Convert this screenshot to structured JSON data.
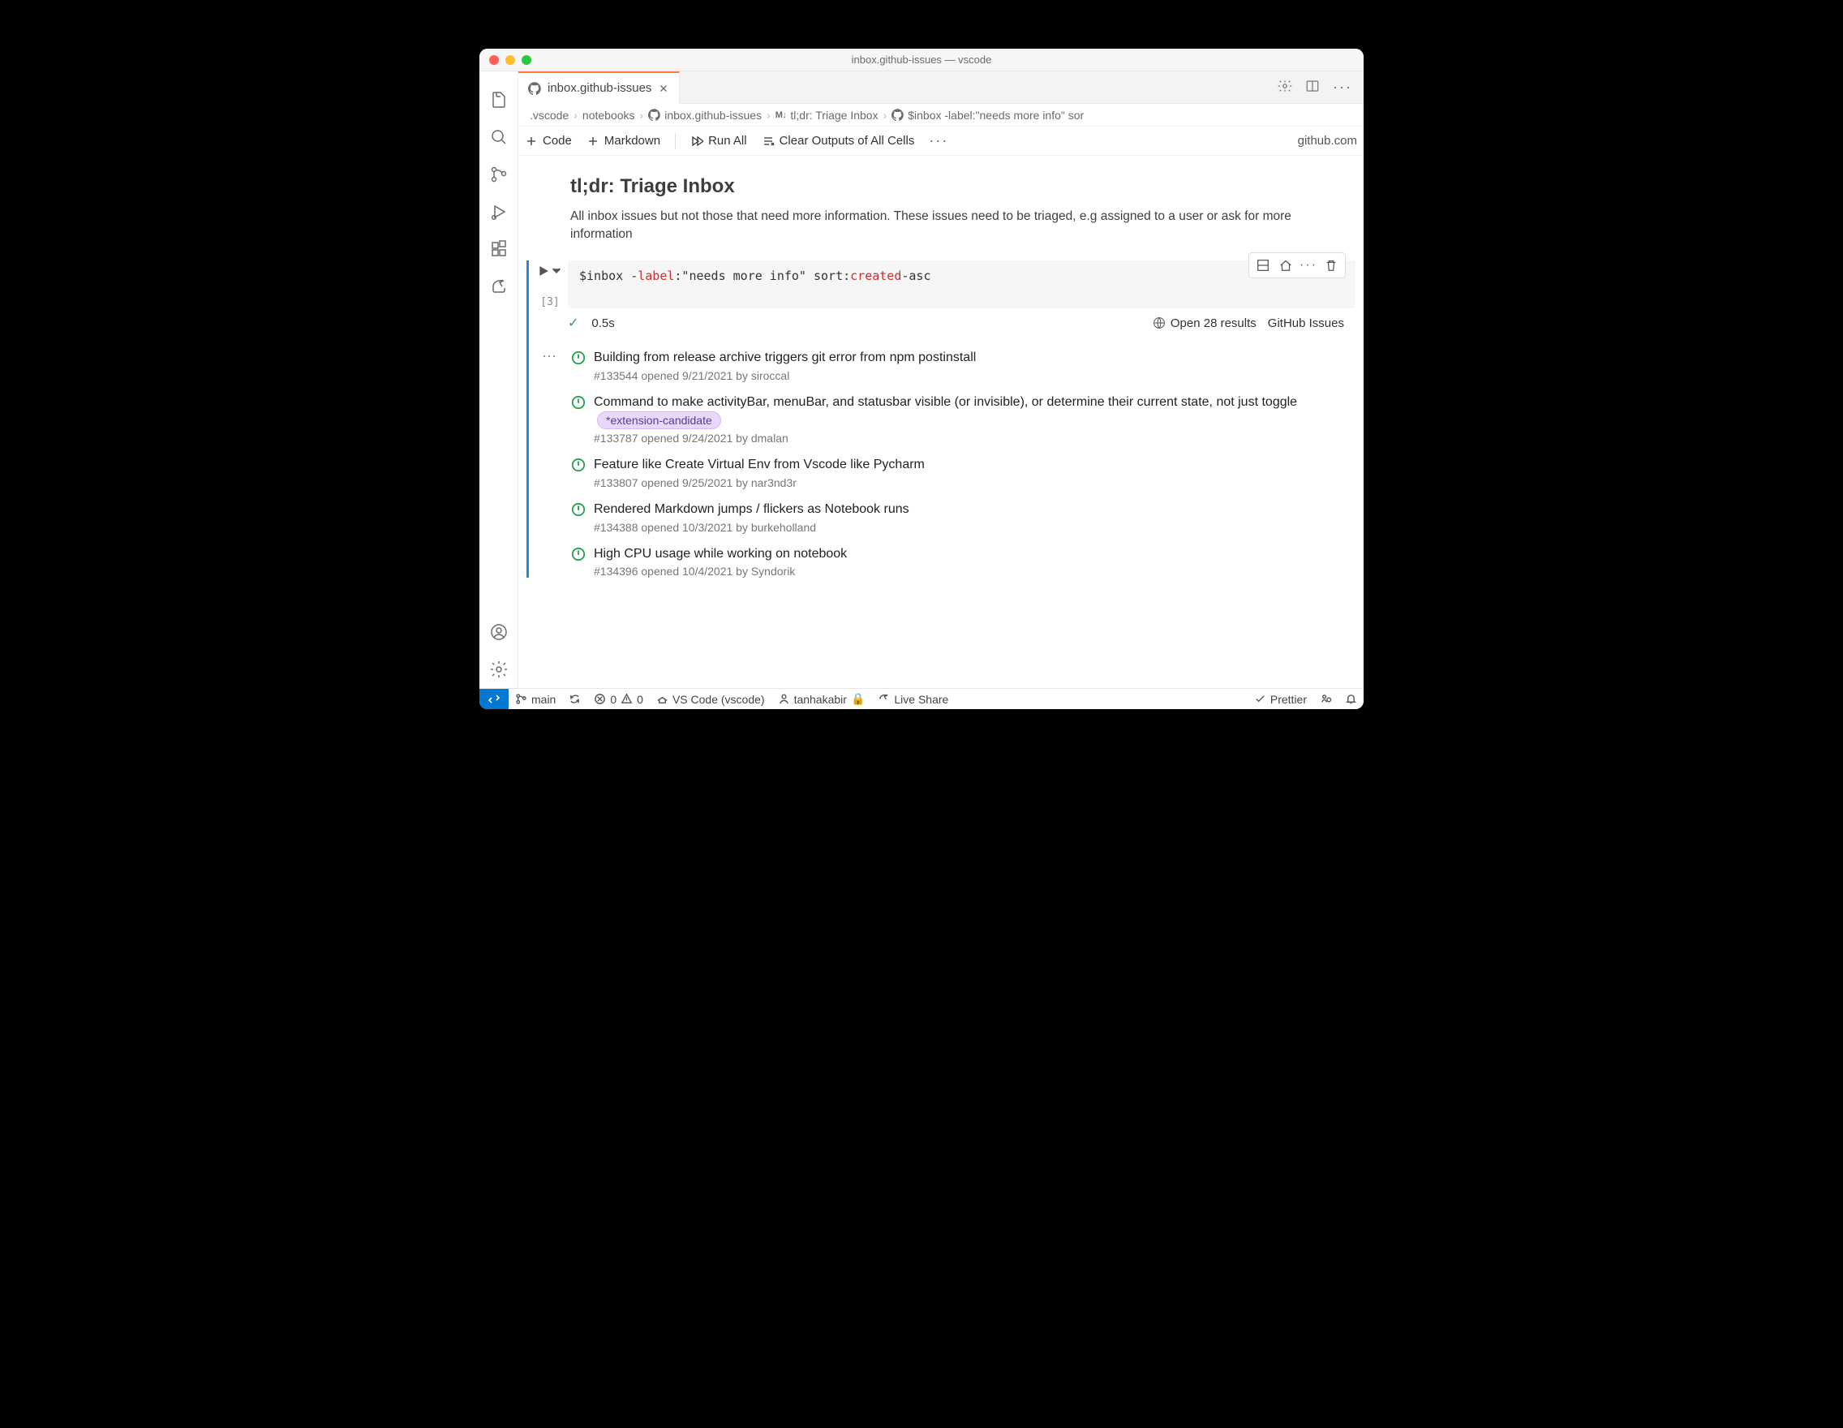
{
  "window": {
    "title": "inbox.github-issues — vscode"
  },
  "tab": {
    "filename": "inbox.github-issues"
  },
  "breadcrumbs": {
    "seg1": ".vscode",
    "seg2": "notebooks",
    "seg3": "inbox.github-issues",
    "seg4": "tl;dr: Triage Inbox",
    "seg5": "$inbox -label:\"needs more info\" sor"
  },
  "toolbar": {
    "code": "Code",
    "markdown": "Markdown",
    "run_all": "Run All",
    "clear_outputs": "Clear Outputs of All Cells",
    "kernel": "github.com"
  },
  "notebook": {
    "heading": "tl;dr: Triage Inbox",
    "description": "All inbox issues but not those that need more information. These issues need to be triaged, e.g assigned to a user or ask for more information"
  },
  "cell": {
    "code_prefix": "$inbox -",
    "code_kw1": "label",
    "code_mid": ":\"needs more info\" sort:",
    "code_kw2": "created",
    "code_suffix": "-asc",
    "exec_count": "[3]",
    "duration": "0.5s",
    "open_results": "Open 28 results",
    "controller": "GitHub Issues"
  },
  "issues": [
    {
      "title": "Building from release archive triggers git error from npm postinstall",
      "meta": "#133544 opened 9/21/2021 by siroccal",
      "label": ""
    },
    {
      "title": "Command to make activityBar, menuBar, and statusbar visible (or invisible), or determine their current state, not just toggle",
      "meta": "#133787 opened 9/24/2021 by dmalan",
      "label": "*extension-candidate"
    },
    {
      "title": "Feature like Create Virtual Env from Vscode like Pycharm",
      "meta": "#133807 opened 9/25/2021 by nar3nd3r",
      "label": ""
    },
    {
      "title": "Rendered Markdown jumps / flickers as Notebook runs",
      "meta": "#134388 opened 10/3/2021 by burkeholland",
      "label": ""
    },
    {
      "title": "High CPU usage while working on notebook",
      "meta": "#134396 opened 10/4/2021 by Syndorik",
      "label": ""
    }
  ],
  "statusbar": {
    "branch": "main",
    "errors": "0",
    "warnings": "0",
    "extension": "VS Code (vscode)",
    "user": "tanhakabir",
    "lock": "🔒",
    "liveshare": "Live Share",
    "prettier": "Prettier"
  }
}
